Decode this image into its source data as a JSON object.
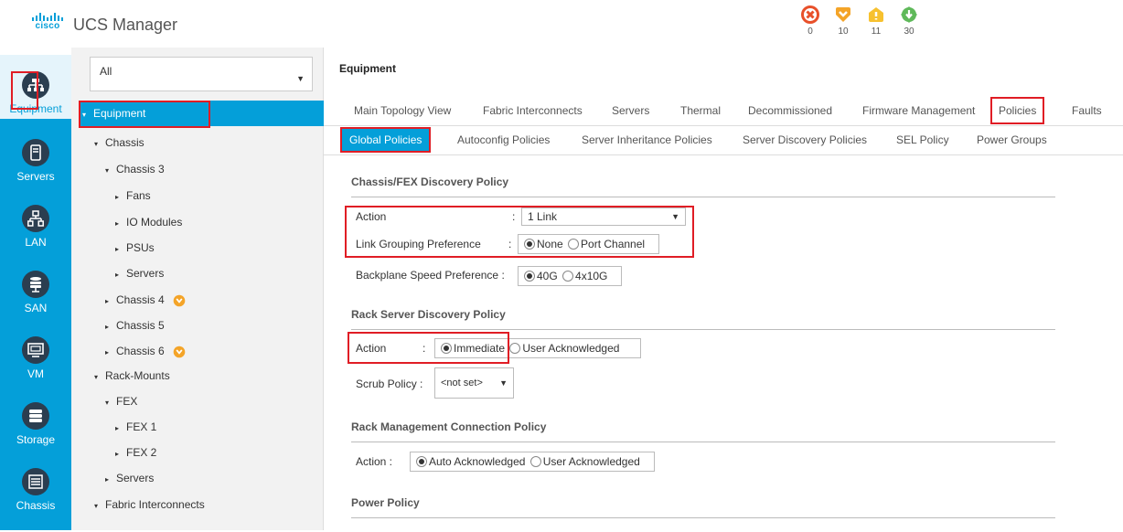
{
  "header": {
    "logo_text": "cisco",
    "app_title": "UCS Manager",
    "faults": [
      {
        "name": "critical",
        "icon": "critical-x-icon",
        "color": "#e8502a",
        "count": "0"
      },
      {
        "name": "major",
        "icon": "major-down-icon",
        "color": "#f4a428",
        "count": "10"
      },
      {
        "name": "minor",
        "icon": "minor-warning-icon",
        "color": "#f7c12f",
        "count": "11"
      },
      {
        "name": "warning",
        "icon": "warning-down-icon",
        "color": "#5fb95a",
        "count": "30"
      }
    ]
  },
  "rail": {
    "items": [
      {
        "label": "Equipment",
        "icon": "equipment-icon",
        "active": true
      },
      {
        "label": "Servers",
        "icon": "servers-icon"
      },
      {
        "label": "LAN",
        "icon": "lan-icon"
      },
      {
        "label": "SAN",
        "icon": "san-icon"
      },
      {
        "label": "VM",
        "icon": "vm-icon"
      },
      {
        "label": "Storage",
        "icon": "storage-icon"
      },
      {
        "label": "Chassis",
        "icon": "chassis-icon"
      }
    ]
  },
  "tree": {
    "filter_value": "All",
    "rows": [
      {
        "label": "Equipment",
        "twisty": "▾"
      },
      {
        "label": "Chassis",
        "twisty": "▾"
      },
      {
        "label": "Chassis 3",
        "twisty": "▾"
      },
      {
        "label": "Fans",
        "twisty": "▸"
      },
      {
        "label": "IO Modules",
        "twisty": "▸"
      },
      {
        "label": "PSUs",
        "twisty": "▸"
      },
      {
        "label": "Servers",
        "twisty": "▸"
      },
      {
        "label": "Chassis 4",
        "twisty": "▸"
      },
      {
        "label": "Chassis 5",
        "twisty": "▸"
      },
      {
        "label": "Chassis 6",
        "twisty": "▸"
      },
      {
        "label": "Rack-Mounts",
        "twisty": "▾"
      },
      {
        "label": "FEX",
        "twisty": "▾"
      },
      {
        "label": "FEX 1",
        "twisty": "▸"
      },
      {
        "label": "FEX 2",
        "twisty": "▸"
      },
      {
        "label": "Servers",
        "twisty": "▸"
      },
      {
        "label": "Fabric Interconnects",
        "twisty": "▾"
      }
    ]
  },
  "main": {
    "breadcrumb": "Equipment",
    "tabs": [
      "Main Topology View",
      "Fabric Interconnects",
      "Servers",
      "Thermal",
      "Decommissioned",
      "Firmware Management",
      "Policies",
      "Faults"
    ],
    "subtabs": [
      "Global Policies",
      "Autoconfig Policies",
      "Server Inheritance Policies",
      "Server Discovery Policies",
      "SEL Policy",
      "Power Groups"
    ],
    "chassis_section": {
      "title": "Chassis/FEX Discovery Policy",
      "action_label": "Action",
      "action_value": "1 Link",
      "link_grouping_label": "Link Grouping Preference",
      "link_grouping_options": [
        "None",
        "Port Channel"
      ],
      "backplane_label": "Backplane Speed Preference :",
      "backplane_options": [
        "40G",
        "4x10G"
      ]
    },
    "rack_section": {
      "title": "Rack Server Discovery Policy",
      "action_label": "Action",
      "action_options": [
        "Immediate",
        "User Acknowledged"
      ],
      "scrub_label": "Scrub Policy :",
      "scrub_value": "<not set>"
    },
    "rack_mgmt_section": {
      "title": "Rack Management Connection Policy",
      "action_label": "Action :",
      "action_options": [
        "Auto Acknowledged",
        "User Acknowledged"
      ]
    },
    "power_section": {
      "title": "Power Policy"
    },
    "colon": ":"
  }
}
